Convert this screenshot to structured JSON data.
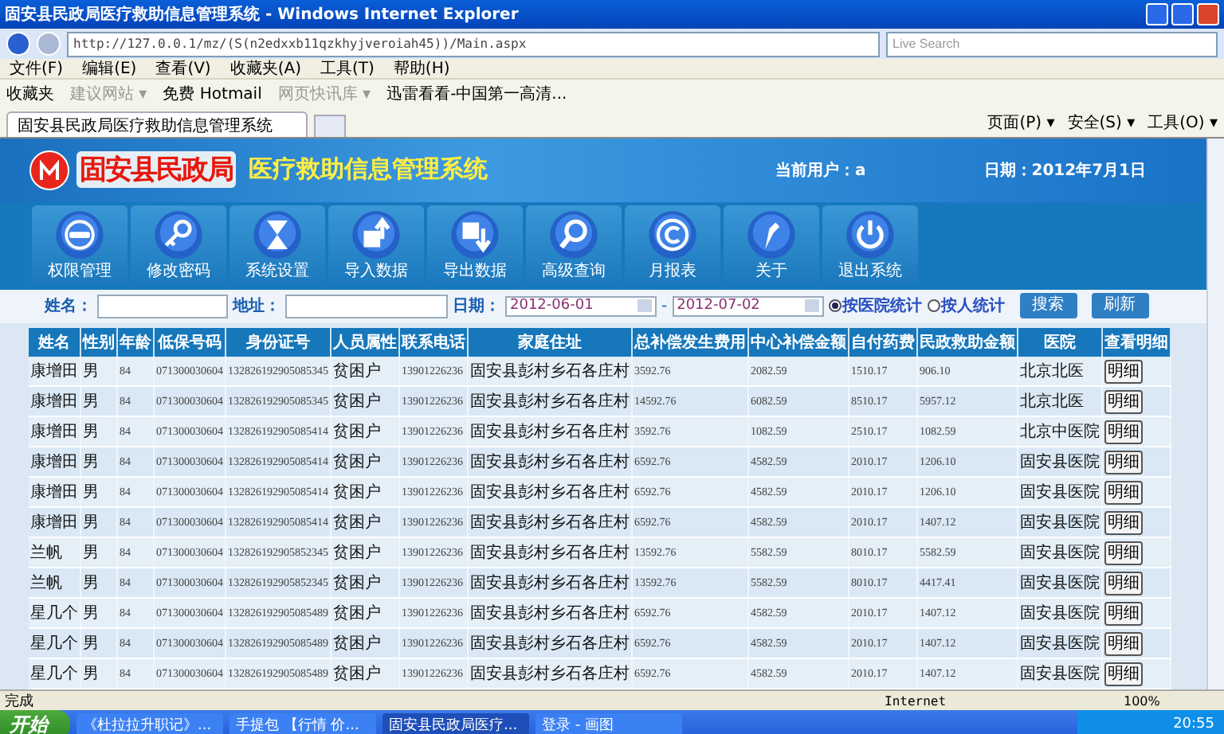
{
  "window": {
    "title": "固安县民政局医疗救助信息管理系统 - Windows Internet Explorer"
  },
  "address_bar": {
    "url": "http://127.0.0.1/mz/(S(n2edxxb11qzkhyjveroiah45))/Main.aspx",
    "search_placeholder": "Live Search"
  },
  "menu": [
    "文件(F)",
    "编辑(E)",
    "查看(V)",
    "收藏夹(A)",
    "工具(T)",
    "帮助(H)"
  ],
  "favorites": {
    "label": "收藏夹",
    "items": [
      {
        "label": "建议网站 ▾",
        "disabled": true
      },
      {
        "label": "免费 Hotmail",
        "disabled": false
      },
      {
        "label": "网页快讯库 ▾",
        "disabled": true
      },
      {
        "label": "迅雷看看-中国第一高清...",
        "disabled": false
      }
    ]
  },
  "tabs": [
    {
      "label": "固安县民政局医疗救助信息管理系统",
      "selected": true
    }
  ],
  "command_bar": [
    "页面(P) ▾",
    "安全(S) ▾",
    "工具(O) ▾"
  ],
  "header": {
    "org": "固安县民政局",
    "system": "医疗救助信息管理系统",
    "user": "当前用户：a",
    "date": "日期：2012年7月1日"
  },
  "toolbar": [
    {
      "label": "权限管理",
      "kind": "minus"
    },
    {
      "label": "修改密码",
      "kind": "key"
    },
    {
      "label": "系统设置",
      "kind": "hourglass"
    },
    {
      "label": "导入数据",
      "kind": "import"
    },
    {
      "label": "导出数据",
      "kind": "export"
    },
    {
      "label": "高级查询",
      "kind": "search"
    },
    {
      "label": "月报表",
      "kind": "copyright"
    },
    {
      "label": "关于",
      "kind": "pen"
    },
    {
      "label": "退出系统",
      "kind": "power"
    }
  ],
  "search": {
    "name_label": "姓名：",
    "address_label": "地址：",
    "date_label": "日期：",
    "date_from": "2012-06-01",
    "date_sep": "-",
    "date_to": "2012-07-02",
    "radios": [
      {
        "label": "按医院统计",
        "selected": true
      },
      {
        "label": "按人统计",
        "selected": false
      }
    ],
    "buttons": [
      "搜索",
      "刷新"
    ]
  },
  "table": {
    "columns": [
      "姓名",
      "性别",
      "年龄",
      "低保号码",
      "身份证号",
      "人员属性",
      "联系电话",
      "家庭住址",
      "总补偿发生费用",
      "中心补偿金额",
      "自付药费",
      "民政救助金额",
      "医院",
      "查看明细"
    ],
    "rows": [
      {
        "cells": [
          "康增田",
          "男",
          "84",
          "071300030604",
          "132826192905085345",
          "贫困户",
          "13901226236",
          "固安县彭村乡石各庄村",
          "3592.76",
          "2082.59",
          "1510.17",
          "906.10",
          "北京北医"
        ],
        "action": "明细"
      },
      {
        "cells": [
          "康增田",
          "男",
          "84",
          "071300030604",
          "132826192905085345",
          "贫困户",
          "13901226236",
          "固安县彭村乡石各庄村",
          "14592.76",
          "6082.59",
          "8510.17",
          "5957.12",
          "北京北医"
        ],
        "action": "明细"
      },
      {
        "cells": [
          "康增田",
          "男",
          "84",
          "071300030604",
          "132826192905085414",
          "贫困户",
          "13901226236",
          "固安县彭村乡石各庄村",
          "3592.76",
          "1082.59",
          "2510.17",
          "1082.59",
          "北京中医院"
        ],
        "action": "明细"
      },
      {
        "cells": [
          "康增田",
          "男",
          "84",
          "071300030604",
          "132826192905085414",
          "贫困户",
          "13901226236",
          "固安县彭村乡石各庄村",
          "6592.76",
          "4582.59",
          "2010.17",
          "1206.10",
          "固安县医院"
        ],
        "action": "明细"
      },
      {
        "cells": [
          "康增田",
          "男",
          "84",
          "071300030604",
          "132826192905085414",
          "贫困户",
          "13901226236",
          "固安县彭村乡石各庄村",
          "6592.76",
          "4582.59",
          "2010.17",
          "1206.10",
          "固安县医院"
        ],
        "action": "明细"
      },
      {
        "cells": [
          "康增田",
          "男",
          "84",
          "071300030604",
          "132826192905085414",
          "贫困户",
          "13901226236",
          "固安县彭村乡石各庄村",
          "6592.76",
          "4582.59",
          "2010.17",
          "1407.12",
          "固安县医院"
        ],
        "action": "明细"
      },
      {
        "cells": [
          "兰帆",
          "男",
          "84",
          "071300030604",
          "132826192905852345",
          "贫困户",
          "13901226236",
          "固安县彭村乡石各庄村",
          "13592.76",
          "5582.59",
          "8010.17",
          "5582.59",
          "固安县医院"
        ],
        "action": "明细"
      },
      {
        "cells": [
          "兰帆",
          "男",
          "84",
          "071300030604",
          "132826192905852345",
          "贫困户",
          "13901226236",
          "固安县彭村乡石各庄村",
          "13592.76",
          "5582.59",
          "8010.17",
          "4417.41",
          "固安县医院"
        ],
        "action": "明细"
      },
      {
        "cells": [
          "星几个",
          "男",
          "84",
          "071300030604",
          "132826192905085489",
          "贫困户",
          "13901226236",
          "固安县彭村乡石各庄村",
          "6592.76",
          "4582.59",
          "2010.17",
          "1407.12",
          "固安县医院"
        ],
        "action": "明细"
      },
      {
        "cells": [
          "星几个",
          "男",
          "84",
          "071300030604",
          "132826192905085489",
          "贫困户",
          "13901226236",
          "固安县彭村乡石各庄村",
          "6592.76",
          "4582.59",
          "2010.17",
          "1407.12",
          "固安县医院"
        ],
        "action": "明细"
      },
      {
        "cells": [
          "星几个",
          "男",
          "84",
          "071300030604",
          "132826192905085489",
          "贫困户",
          "13901226236",
          "固安县彭村乡石各庄村",
          "6592.76",
          "4582.59",
          "2010.17",
          "1407.12",
          "固安县医院"
        ],
        "action": "明细"
      }
    ]
  },
  "status_bar": {
    "text": "完成",
    "zone": "Internet",
    "zoom": "100%"
  },
  "taskbar": {
    "start": "开始",
    "tasks": [
      {
        "label": "《杜拉拉升职记》...",
        "selected": false
      },
      {
        "label": "手提包 【行情 价...",
        "selected": false
      },
      {
        "label": "固安县民政局医疗...",
        "selected": true
      },
      {
        "label": "登录 - 画图",
        "selected": false
      }
    ],
    "clock": "20:55"
  }
}
